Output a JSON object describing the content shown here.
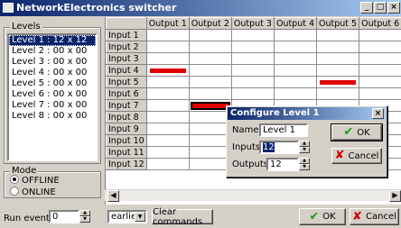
{
  "window": {
    "title": "NetworkElectronics switcher",
    "minimize": "_",
    "restore": "□",
    "close": "×"
  },
  "levels": {
    "group_label": "Levels",
    "items": [
      "Level 1 : 12 x 12",
      "Level 2 : 00 x 00",
      "Level 3 : 00 x 00",
      "Level 4 : 00 x 00",
      "Level 5 : 00 x 00",
      "Level 6 : 00 x 00",
      "Level 7 : 00 x 00",
      "Level 8 : 00 x 00"
    ],
    "selected_index": 0
  },
  "mode": {
    "group_label": "Mode",
    "options": [
      "OFFLINE",
      "ONLINE"
    ],
    "selected": "OFFLINE"
  },
  "grid": {
    "columns": [
      "Output 1",
      "Output 2",
      "Output 3",
      "Output 4",
      "Output 5",
      "Output 6",
      "Output"
    ],
    "rows": [
      "Input 1",
      "Input 2",
      "Input 3",
      "Input 4",
      "Input 5",
      "Input 6",
      "Input 7",
      "Input 8",
      "Input 9",
      "Input 10",
      "Input 11",
      "Input 12"
    ],
    "crosspoints": [
      {
        "input": "Input 4",
        "output": "Output 1"
      },
      {
        "input": "Input 5",
        "output": "Output 5"
      },
      {
        "input": "Input 7",
        "output": "Output 2",
        "selected": true
      }
    ],
    "mark_color": "#e00000"
  },
  "dialog": {
    "title": "Configure Level 1",
    "close": "×",
    "name_label": "Name",
    "name_value": "Level 1",
    "inputs_label": "Inputs",
    "inputs_value": "12",
    "outputs_label": "Outputs",
    "outputs_value": "12",
    "ok_label": "OK",
    "cancel_label": "Cancel"
  },
  "bottom": {
    "run_event_label": "Run event",
    "run_event_value": "0",
    "order_value": "earlier",
    "clear_label": "Clear commands",
    "ok_label": "OK",
    "cancel_label": "Cancel"
  },
  "colors": {
    "titlebar": "#0a246a",
    "selection": "#0a246a",
    "ok_icon": "#1a9a1a",
    "cancel_icon": "#d10000"
  }
}
